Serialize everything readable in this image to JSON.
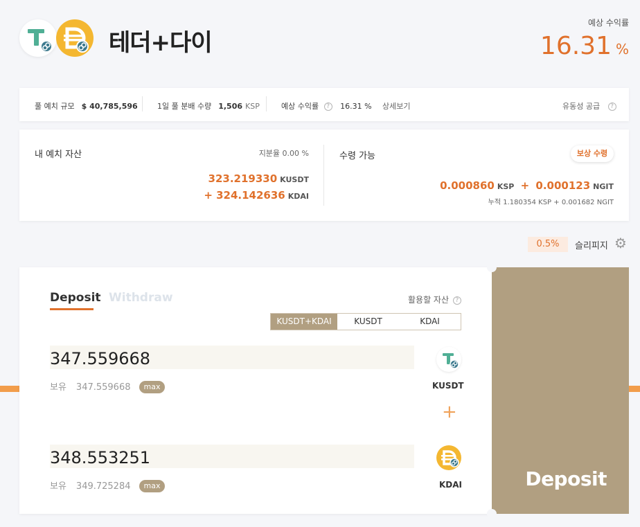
{
  "header": {
    "pool_name": "테더+다이",
    "apr_label": "예상 수익률",
    "apr_value": "16.31",
    "apr_unit": "%"
  },
  "info_bar": {
    "pool_size_label": "풀 예치 규모",
    "pool_size_value": "$  40,785,596",
    "daily_label": "1일 풀 분배 수량",
    "daily_value": "1,506",
    "daily_unit": "KSP",
    "apr_label": "예상 수익률",
    "apr_value": "16.31 %",
    "details_link": "상세보기",
    "liquidity_label": "유동성 공급"
  },
  "my_assets": {
    "title": "내 예치 자산",
    "share_label": "지분율 0.00 %",
    "amount1": "323.219330",
    "unit1": "KUSDT",
    "amount2": "+ 324.142636",
    "unit2": "KDAI"
  },
  "claimable": {
    "title": "수령 가능",
    "claim_button": "보상 수령",
    "ksp_amount": "0.000860",
    "ksp_unit": "KSP",
    "plus": "+",
    "ngit_amount": "0.000123",
    "ngit_unit": "NGIT",
    "cumulative": "누적 1.180354 KSP + 0.001682 NGIT"
  },
  "slippage": {
    "value": "0.5%",
    "label": "슬리피지"
  },
  "panel": {
    "tab_deposit": "Deposit",
    "tab_withdraw": "Withdraw",
    "use_asset_label": "활용할 자산",
    "segments": [
      "KUSDT+KDAI",
      "KUSDT",
      "KDAI"
    ],
    "token1": {
      "amount": "347.559668",
      "balance_label": "보유",
      "balance": "347.559668",
      "max_label": "max",
      "symbol": "KUSDT"
    },
    "plus": "+",
    "token2": {
      "amount": "348.553251",
      "balance_label": "보유",
      "balance": "349.725284",
      "max_label": "max",
      "symbol": "KDAI"
    },
    "deposit_button": "Deposit"
  },
  "icons": {
    "usdt": "tether-icon",
    "dai": "dai-icon",
    "help": "help-icon",
    "settings": "gear-icon"
  },
  "colors": {
    "accent": "#e0712c",
    "brand": "#b19f81",
    "usdt": "#50af95",
    "dai": "#f4b731"
  }
}
